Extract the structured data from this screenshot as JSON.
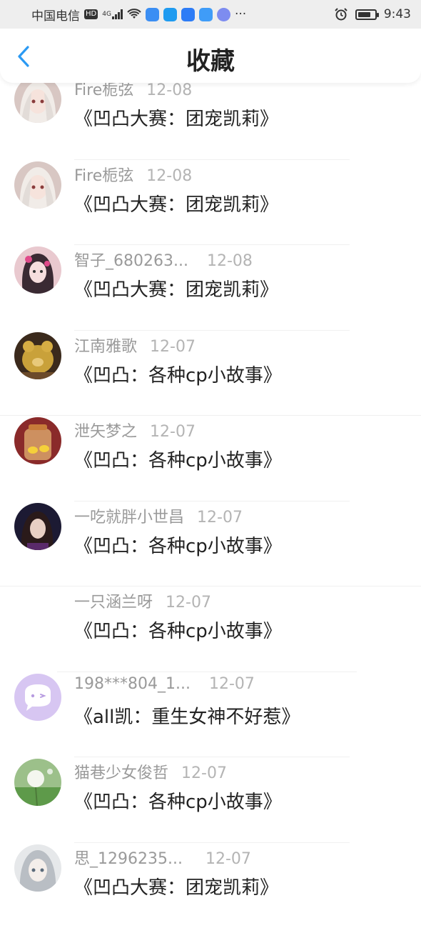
{
  "status_bar": {
    "carrier": "中国电信",
    "hd_badge": "HD",
    "network": "4G",
    "more": "···",
    "time": "9:43",
    "app_icon_colors": [
      "#3b8ef3",
      "#1f9bf0",
      "#2d7cf6",
      "#3f9cf8",
      "#7d8cf0"
    ]
  },
  "header": {
    "title": "收藏",
    "back_icon": "chevron-left-icon",
    "back_color": "#2b9af3"
  },
  "items": [
    {
      "author": "Fire栀弦",
      "date": "12-08",
      "title": "《凹凸大赛：团宠凯莉》",
      "avatar": "anime-girl-white-hair"
    },
    {
      "author": "Fire栀弦",
      "date": "12-08",
      "title": "《凹凸大赛：团宠凯莉》",
      "avatar": "anime-girl-white-hair"
    },
    {
      "author": "智子_680263...",
      "date": "12-08",
      "title": "《凹凸大赛：团宠凯莉》",
      "avatar": "anime-girl-flowers"
    },
    {
      "author": "江南雅歌",
      "date": "12-07",
      "title": "《凹凸：各种cp小故事》",
      "avatar": "teddy-bear"
    },
    {
      "author": "泄矢梦之",
      "date": "12-07",
      "title": "《凹凸：各种cp小故事》",
      "avatar": "jar-ducks"
    },
    {
      "author": "一吃就胖小世昌",
      "date": "12-07",
      "title": "《凹凸：各种cp小故事》",
      "avatar": "girl-portrait"
    },
    {
      "author": "一只涵兰呀",
      "date": "12-07",
      "title": "《凹凸：各种cp小故事》",
      "avatar": "none"
    },
    {
      "author": "198***804_1...",
      "date": "12-07",
      "title": "《all凯：重生女神不好惹》",
      "avatar": "default-chat-bubble"
    },
    {
      "author": "猫巷少女俊哲",
      "date": "12-07",
      "title": "《凹凸：各种cp小故事》",
      "avatar": "dandelion"
    },
    {
      "author": "思_1296235...",
      "date": "12-07",
      "title": "《凹凸大赛：团宠凯莉》",
      "avatar": "anime-girl-grey"
    }
  ]
}
